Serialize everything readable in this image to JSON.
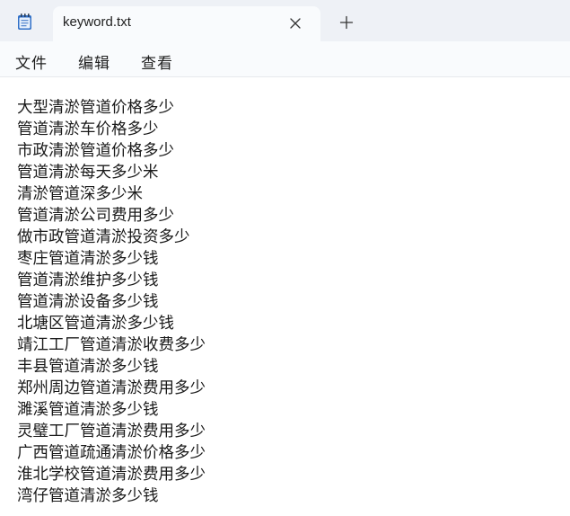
{
  "tab": {
    "title": "keyword.txt"
  },
  "icons": {
    "app": "notepad-icon",
    "close": "close-icon",
    "new_tab": "plus-icon"
  },
  "menu": {
    "items": [
      {
        "label": "文件"
      },
      {
        "label": "编辑"
      },
      {
        "label": "查看"
      }
    ]
  },
  "document": {
    "lines": [
      "大型清淤管道价格多少",
      "管道清淤车价格多少",
      "市政清淤管道价格多少",
      "管道清淤每天多少米",
      "清淤管道深多少米",
      "管道清淤公司费用多少",
      "做市政管道清淤投资多少",
      "枣庄管道清淤多少钱",
      "管道清淤维护多少钱",
      "管道清淤设备多少钱",
      "北塘区管道清淤多少钱",
      "靖江工厂管道清淤收费多少",
      "丰县管道清淤多少钱",
      "郑州周边管道清淤费用多少",
      "濉溪管道清淤多少钱",
      "灵璧工厂管道清淤费用多少",
      "广西管道疏通清淤价格多少",
      "淮北学校管道清淤费用多少",
      "湾仔管道清淤多少钱"
    ]
  },
  "colors": {
    "titlebar_bg": "#eef1f6",
    "tab_bg": "#f9fbfd",
    "editor_bg": "#ffffff",
    "text": "#1a1a1a",
    "icon_blue": "#3b7bd4"
  }
}
